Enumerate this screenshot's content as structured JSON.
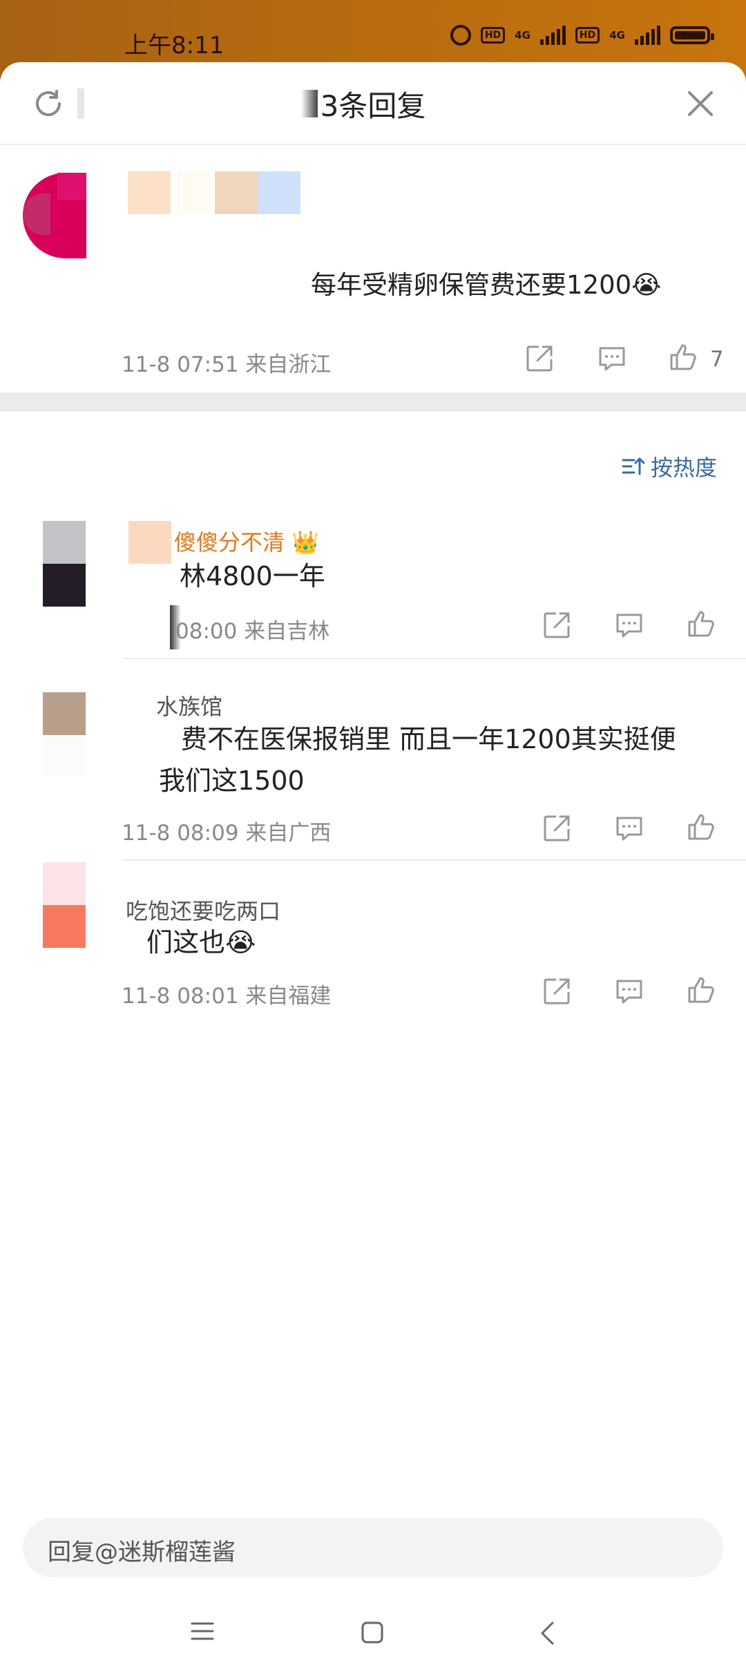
{
  "status_bar": {
    "time": "上午8:11",
    "hd": "HD",
    "network": "4G"
  },
  "header": {
    "title": "3条回复",
    "refresh_icon": "refresh-icon",
    "close_icon": "close-icon"
  },
  "original_comment": {
    "text": "每年受精卵保管费还要1200😭",
    "meta": "11-8 07:51  来自浙江",
    "like_count": "7"
  },
  "sort": {
    "label": "按热度"
  },
  "replies": [
    {
      "name": "傻傻分不清",
      "badge": "👑",
      "text": "林4800一年",
      "meta": "08:00  来自吉林"
    },
    {
      "name": "水族馆",
      "text_line1": "费不在医保报销里 而且一年1200其实挺便",
      "text_line2": "我们这1500",
      "meta": "11-8 08:09  来自广西"
    },
    {
      "name": "吃饱还要吃两口",
      "text": "们这也😭",
      "meta": "11-8 08:01  来自福建"
    }
  ],
  "reply_box": {
    "placeholder": "回复@迷斯榴莲酱"
  },
  "colors": {
    "status_bar": "#b86c0f",
    "accent_link": "#3a6aa0",
    "vip_name": "#e07a1a",
    "divider": "#ebebeb"
  }
}
